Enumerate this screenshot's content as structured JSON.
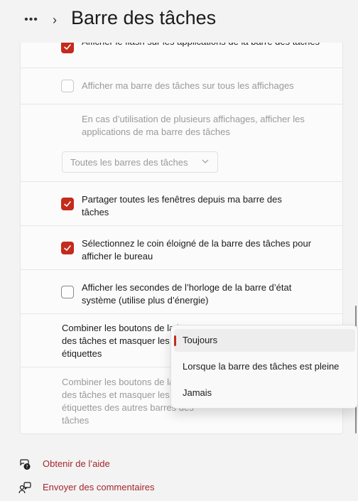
{
  "header": {
    "more_label": "•••",
    "chevron": "›",
    "title": "Barre des tâches"
  },
  "settings": {
    "flash_label": "Afficher le flash sur les applications de la barre des tâches",
    "all_displays_label": "Afficher ma barre des tâches sur tous les affichages",
    "multi_display_label": "En cas d’utilisation de plusieurs affichages, afficher les applications de ma barre des tâches",
    "multi_display_select_value": "Toutes les barres des tâches",
    "share_windows_label": "Partager toutes les fenêtres depuis ma barre des tâches",
    "far_corner_label": "Sélectionnez le coin éloigné de la barre des tâches pour afficher le bureau",
    "clock_seconds_label": "Afficher les secondes de l’horloge de la barre d’état système (utilise plus d’énergie)",
    "combine_label": "Combiner les boutons de la barre des tâches et masquer les étiquettes",
    "combine_other_label": "Combiner les boutons de la barre des tâches et masquer les étiquettes des autres barres des tâches"
  },
  "combine_menu": {
    "options": [
      "Toujours",
      "Lorsque la barre des tâches est pleine",
      "Jamais"
    ],
    "selected": "Toujours"
  },
  "links": {
    "help": "Obtenir de l’aide",
    "feedback": "Envoyer des commentaires"
  },
  "colors": {
    "accent": "#c42b1c",
    "link": "#a4262c"
  }
}
